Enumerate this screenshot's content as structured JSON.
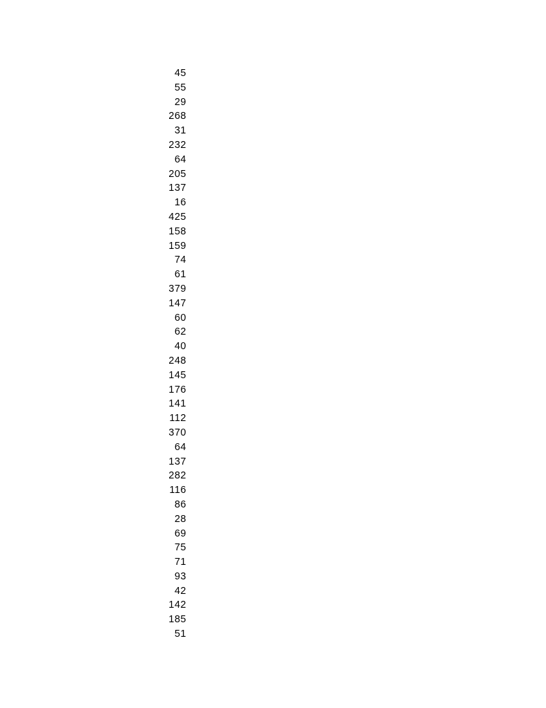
{
  "numbers": [
    "45",
    "55",
    "29",
    "268",
    "31",
    "232",
    "64",
    "205",
    "137",
    "16",
    "425",
    "158",
    "159",
    "74",
    "61",
    "379",
    "147",
    "60",
    "62",
    "40",
    "248",
    "145",
    "176",
    "141",
    "112",
    "370",
    "64",
    "137",
    "282",
    "116",
    "86",
    "28",
    "69",
    "75",
    "71",
    "93",
    "42",
    "142",
    "185",
    "51"
  ]
}
